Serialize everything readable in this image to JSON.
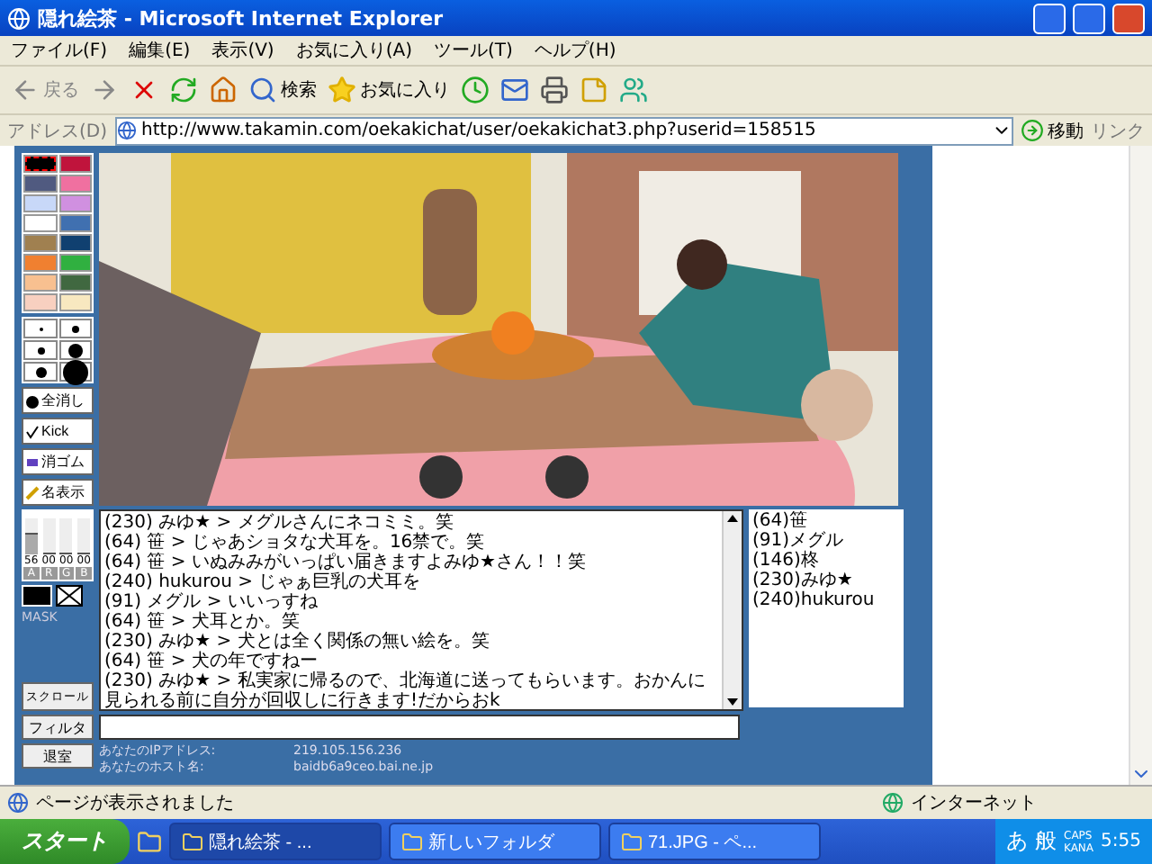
{
  "window": {
    "title": "隠れ絵茶 - Microsoft Internet Explorer"
  },
  "menu": [
    "ファイル(F)",
    "編集(E)",
    "表示(V)",
    "お気に入り(A)",
    "ツール(T)",
    "ヘルプ(H)"
  ],
  "toolbar": {
    "back": "戻る",
    "search": "検索",
    "favorites": "お気に入り"
  },
  "address": {
    "label": "アドレス(D)",
    "value": "http://www.takamin.com/oekakichat/user/oekakichat3.php?userid=158515",
    "go": "移動",
    "links": "リンク"
  },
  "palette": [
    {
      "color": "#000000",
      "selected": true
    },
    {
      "color": "#c0143c",
      "selected": false
    },
    {
      "color": "#505a80",
      "selected": false
    },
    {
      "color": "#f070a0",
      "selected": false
    },
    {
      "color": "#c8d8f8",
      "selected": false
    },
    {
      "color": "#d090e0",
      "selected": false
    },
    {
      "color": "#ffffff",
      "selected": false
    },
    {
      "color": "#4070b0",
      "selected": false
    },
    {
      "color": "#a08050",
      "selected": false
    },
    {
      "color": "#104070",
      "selected": false
    },
    {
      "color": "#f08030",
      "selected": false
    },
    {
      "color": "#30b040",
      "selected": false
    },
    {
      "color": "#f8c090",
      "selected": false
    },
    {
      "color": "#406840",
      "selected": false
    },
    {
      "color": "#f8d0c0",
      "selected": false
    },
    {
      "color": "#f8e8c0",
      "selected": false
    }
  ],
  "tools": [
    {
      "kind": "clear",
      "label": "全消し"
    },
    {
      "kind": "kick",
      "label": "Kick"
    },
    {
      "kind": "eraser",
      "label": "消ゴム"
    },
    {
      "kind": "names",
      "label": "名表示"
    }
  ],
  "channels": [
    {
      "label": "A",
      "value": "56",
      "level": 0.55
    },
    {
      "label": "R",
      "value": "00",
      "level": 0
    },
    {
      "label": "G",
      "value": "00",
      "level": 0
    },
    {
      "label": "B",
      "value": "00",
      "level": 0
    }
  ],
  "mask_label": "MASK",
  "canvas": {
    "kind": "picture"
  },
  "chat": [
    "(230) みゆ★ > メグルさんにネコミミ。笑",
    "(64) 笹 > じゃあショタな犬耳を。16禁で。笑",
    "(64) 笹 > いぬみみがいっぱい届きますよみゆ★さん！！笑",
    "(240) hukurou > じゃぁ巨乳の犬耳を",
    "(91) メグル > いいっすね",
    "(64) 笹 > 犬耳とか。笑",
    "(230) みゆ★ > 犬とは全く関係の無い絵を。笑",
    "(64) 笹 > 犬の年ですねー",
    "(230) みゆ★ > 私実家に帰るので、北海道に送ってもらいます。おかんに見られる前に自分が回収しに行きます!だからおk"
  ],
  "users": [
    "(64)笹",
    "(91)メグル",
    "(146)柊",
    "(230)みゆ★",
    "(240)hukurou"
  ],
  "buttons": {
    "scroll": "スクロール",
    "filter": "フィルタ",
    "leave": "退室"
  },
  "info": [
    {
      "label": "あなたのIPアドレス:",
      "value": "219.105.156.236"
    },
    {
      "label": "あなたのホスト名:",
      "value": "baidb6a9ceo.bai.ne.jp"
    }
  ],
  "status": {
    "text": "ページが表示されました",
    "zone": "インターネット"
  },
  "taskbar": {
    "start": "スタート",
    "tasks": [
      {
        "label": "隠れ絵茶 - ...",
        "selected": true
      },
      {
        "label": "新しいフォルダ",
        "selected": false
      },
      {
        "label": "71.JPG - ペ...",
        "selected": false
      }
    ],
    "ime": [
      "あ",
      "般"
    ],
    "locks": [
      "CAPS",
      "KANA"
    ],
    "clock": "5:55"
  }
}
